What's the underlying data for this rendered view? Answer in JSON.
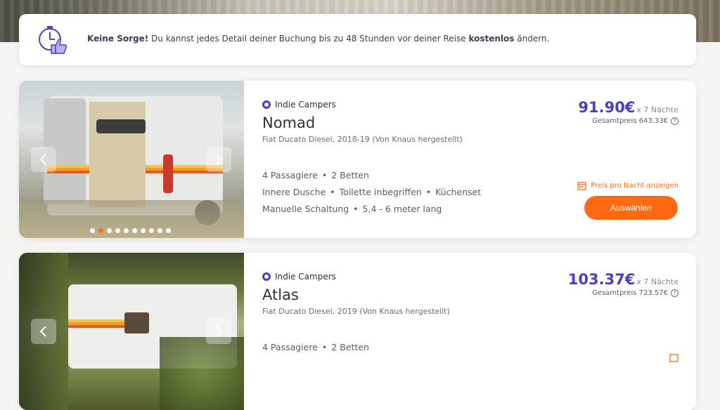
{
  "banner": {
    "bold_prefix": "Keine Sorge!",
    "text_middle": " Du kannst jedes Detail deiner Buchung bis zu 48 Stunden vor deiner Reise ",
    "bold_word": "kostenlos",
    "text_suffix": " ändern.",
    "icon": "timer-thumbs-up-icon"
  },
  "listings": [
    {
      "brand": "Indie Campers",
      "title": "Nomad",
      "subtitle": "Fiat Ducato Diesel, 2018-19 (Von Knaus hergestellt)",
      "features": {
        "row1": [
          "4 Passagiere",
          "2 Betten"
        ],
        "row2": [
          "Innere Dusche",
          "Toilette inbegriffen",
          "Küchenset"
        ],
        "row3": [
          "Manuelle Schaltung",
          "5,4 - 6 meter lang"
        ]
      },
      "price": "91.90€",
      "nights": "x 7 Nächte",
      "total": "Gesamtpreis 643.33€",
      "night_link": "Preis pro Nacht anzeigen",
      "select_label": "Auswählen",
      "carousel_dots": 10,
      "carousel_active": 1
    },
    {
      "brand": "Indie Campers",
      "title": "Atlas",
      "subtitle": "Fiat Ducato Diesel, 2019 (Von Knaus hergestellt)",
      "features": {
        "row1": [
          "4 Passagiere",
          "2 Betten"
        ]
      },
      "price": "103.37€",
      "nights": "x 7 Nächte",
      "total": "Gesamtpreis 723.57€"
    }
  ],
  "colors": {
    "accent": "#ff6a13",
    "brand": "#4b3ec2",
    "text": "#3d3d4e"
  }
}
